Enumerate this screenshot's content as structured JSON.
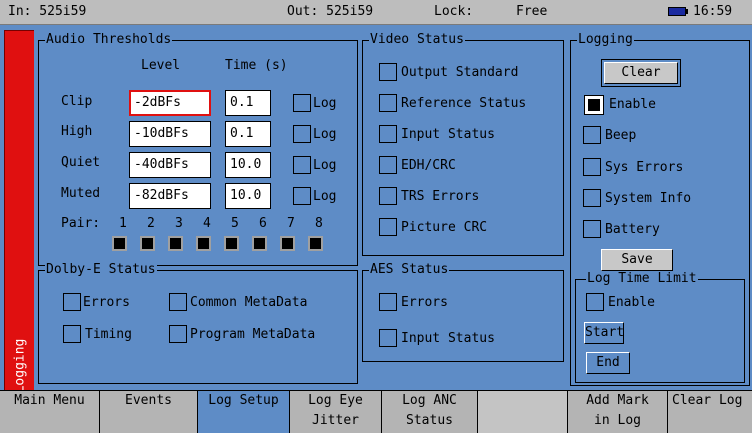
{
  "status": {
    "in": "In: 525i59",
    "out": "Out: 525i59",
    "lock_label": "Lock:",
    "lock_value": "Free",
    "time": "16:59"
  },
  "sidetab": "Logging",
  "audio": {
    "title": "Audio Thresholds",
    "col_level": "Level",
    "col_time": "Time (s)",
    "log_label": "Log",
    "rows": [
      {
        "label": "Clip",
        "level": "-2dBFs",
        "time": "0.1"
      },
      {
        "label": "High",
        "level": "-10dBFs",
        "time": "0.1"
      },
      {
        "label": "Quiet",
        "level": "-40dBFs",
        "time": "10.0"
      },
      {
        "label": "Muted",
        "level": "-82dBFs",
        "time": "10.0"
      }
    ],
    "pair_label": "Pair:",
    "pairs": [
      "1",
      "2",
      "3",
      "4",
      "5",
      "6",
      "7",
      "8"
    ]
  },
  "video": {
    "title": "Video Status",
    "items": [
      "Output Standard",
      "Reference Status",
      "Input Status",
      "EDH/CRC",
      "TRS Errors",
      "Picture CRC"
    ]
  },
  "logging": {
    "title": "Logging",
    "clear": "Clear",
    "items": [
      "Enable",
      "Beep",
      "Sys Errors",
      "System Info",
      "Battery"
    ],
    "save": "Save",
    "limit_title": "Log Time Limit",
    "limit_enable": "Enable",
    "start": "Start",
    "end": "End"
  },
  "dolby": {
    "title": "Dolby-E Status",
    "errors": "Errors",
    "common": "Common MetaData",
    "timing": "Timing",
    "program": "Program MetaData"
  },
  "aes": {
    "title": "AES Status",
    "errors": "Errors",
    "input": "Input Status"
  },
  "menu": {
    "main": "Main Menu",
    "events": "Events",
    "logsetup": "Log Setup",
    "eye1": "Log Eye",
    "eye2": "Jitter",
    "anc1": "Log ANC",
    "anc2": "Status",
    "mark1": "Add Mark",
    "mark2": "in Log",
    "clearlog": "Clear Log"
  },
  "colors": {
    "panel": "#5e8cc6",
    "tab_red": "#e01010",
    "bar_gray": "#bdbdbd"
  },
  "icons": {
    "battery": "battery-icon"
  }
}
